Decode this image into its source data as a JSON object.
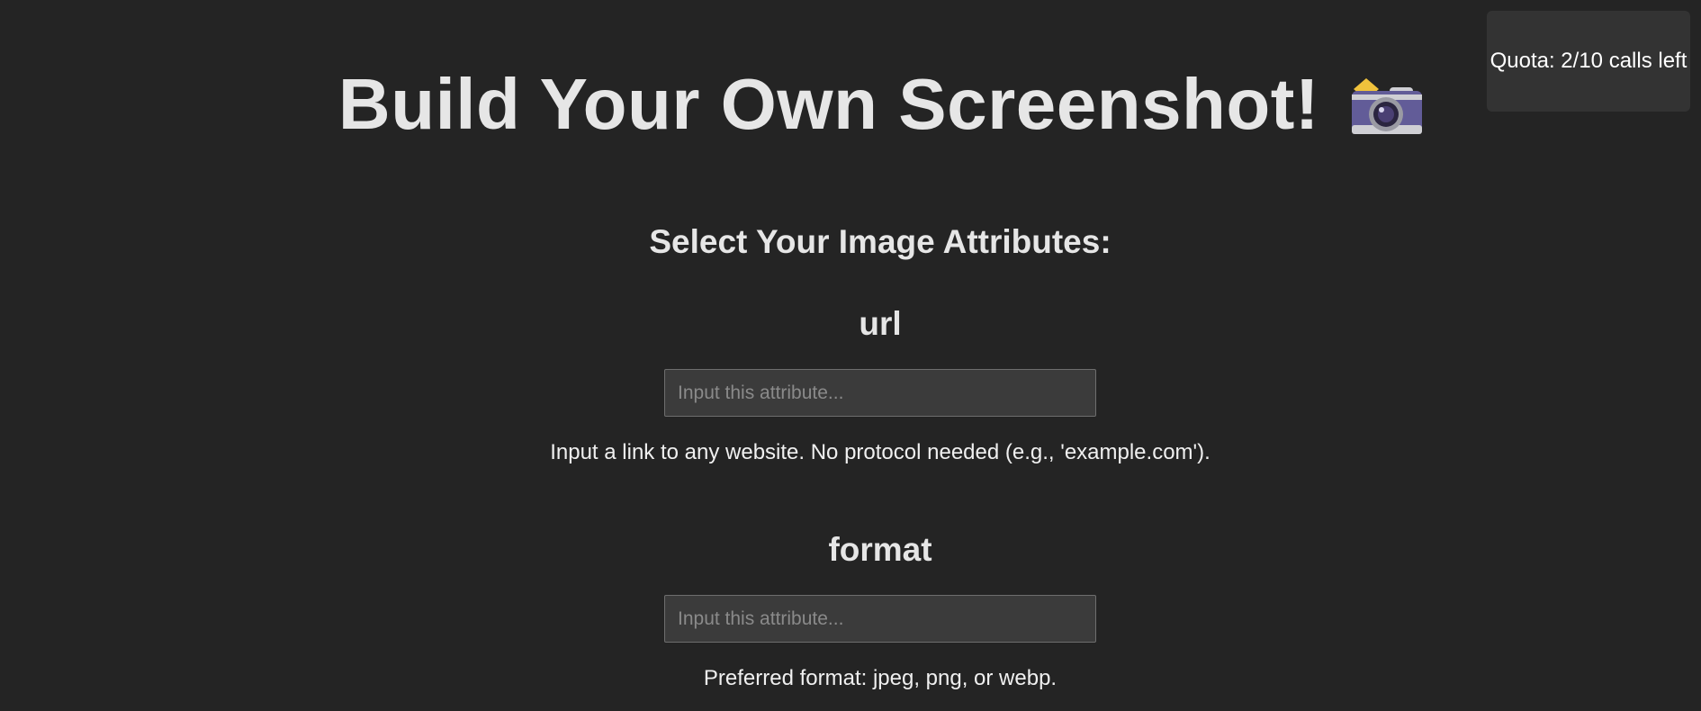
{
  "quota": {
    "text": "Quota: 2/10 calls left"
  },
  "header": {
    "title": "Build Your Own Screenshot!",
    "icon": "camera-icon"
  },
  "form": {
    "heading": "Select Your Image Attributes:",
    "attributes": [
      {
        "name": "url",
        "value": "",
        "placeholder": "Input this attribute...",
        "help": "Input a link to any website. No protocol needed (e.g., 'example.com')."
      },
      {
        "name": "format",
        "value": "",
        "placeholder": "Input this attribute...",
        "help": "Preferred format: jpeg, png, or webp."
      }
    ]
  },
  "colors": {
    "background": "#242424",
    "panel": "#333333",
    "input_bg": "#3b3b3b",
    "text": "#e6e6e6"
  }
}
